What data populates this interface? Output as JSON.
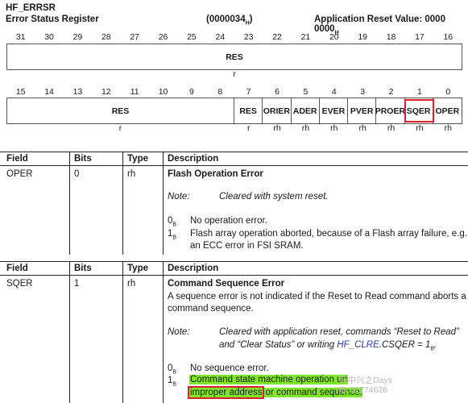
{
  "register": {
    "name": "HF_ERRSR",
    "title": "Error Status Register",
    "offset": "(0000034",
    "offset_sub": "H",
    "offset_close": ")",
    "reset_label": "Application Reset Value: 0000 0000",
    "reset_sub": "H"
  },
  "upper": {
    "bit_numbers": [
      "31",
      "30",
      "29",
      "28",
      "27",
      "26",
      "25",
      "24",
      "23",
      "22",
      "21",
      "20",
      "19",
      "18",
      "17",
      "16"
    ],
    "field_label": "RES",
    "access": "r"
  },
  "lower": {
    "bit_numbers": [
      "15",
      "14",
      "13",
      "12",
      "11",
      "10",
      "9",
      "8",
      "7",
      "6",
      "5",
      "4",
      "3",
      "2",
      "1",
      "0"
    ],
    "fields": [
      "RES",
      "RES",
      "ORIER",
      "ADER",
      "EVER",
      "PVER",
      "PROER",
      "SQER",
      "OPER"
    ],
    "access": [
      "r",
      "r",
      "rh",
      "rh",
      "rh",
      "rh",
      "rh",
      "rh",
      "rh"
    ]
  },
  "table_headers": [
    "Field",
    "Bits",
    "Type",
    "Description"
  ],
  "oper": {
    "field": "OPER",
    "bits": "0",
    "type": "rh",
    "title": "Flash Operation Error",
    "note_label": "Note:",
    "note_text": "Cleared with system reset.",
    "v0_code": "0",
    "v0_sub": "B",
    "v0_text": "No operation error.",
    "v1_code": "1",
    "v1_sub": "B",
    "v1_line1": "Flash array operation aborted, because of a Flash array failure, e.g.",
    "v1_line2": "an ECC error in FSI SRAM."
  },
  "sqer": {
    "field": "SQER",
    "bits": "1",
    "type": "rh",
    "title": "Command Sequence Error",
    "para_line1": "A sequence error is not indicated if the Reset to Read command aborts a",
    "para_line2": "command sequence.",
    "note_label": "Note:",
    "note_line1": "Cleared with application reset, commands “Reset to Read”",
    "note_line2_a": "and “Clear Status” or writing ",
    "note_line2_link": "HF_CLRE",
    "note_line2_b": ".CSQER = 1",
    "note_line2_sub": "B",
    "note_line2_end": ".",
    "v0_code": "0",
    "v0_sub": "B",
    "v0_text": "No sequence error.",
    "v1_code": "1",
    "v1_sub": "B",
    "v1_line1": "Command state machine operation un",
    "v1_line2_hl": "improper address",
    "v1_line2_rest": " or command sequence."
  },
  "watermark": {
    "line1": "新中兴之Days",
    "line2": "ID:82774626"
  }
}
